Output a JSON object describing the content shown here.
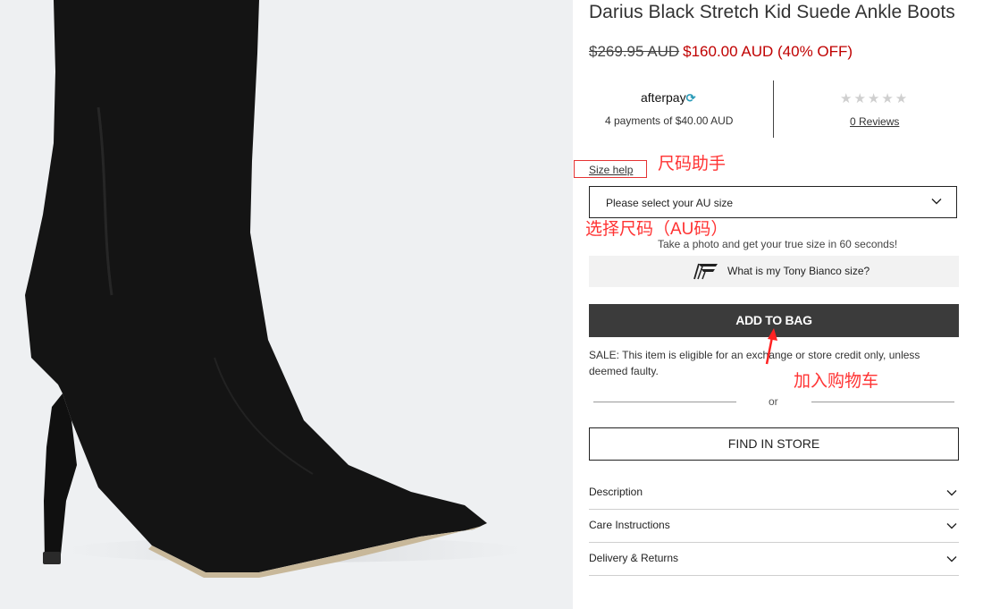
{
  "product": {
    "title": "Darius Black Stretch Kid Suede Ankle Boots",
    "old_price": "$269.95 AUD",
    "new_price": "$160.00 AUD (40% OFF)"
  },
  "afterpay": {
    "logo_text": "afterpay",
    "installments": "4 payments of $40.00 AUD"
  },
  "reviews": {
    "stars": "★★★★★",
    "rating": 0,
    "link": "0 Reviews"
  },
  "size": {
    "help_link": "Size help",
    "select_placeholder": "Please select your AU size",
    "photo_text": "Take a photo and get your true size in 60 seconds!",
    "tony_button": "What is my Tony Bianco size?"
  },
  "cart": {
    "add_to_bag": "ADD TO BAG",
    "sale_note": "SALE: This item is eligible for an exchange or store credit only, unless deemed faulty.",
    "or_text": "or",
    "find_in_store": "FIND IN STORE"
  },
  "accordion": [
    {
      "label": "Description"
    },
    {
      "label": "Care Instructions"
    },
    {
      "label": "Delivery & Returns"
    }
  ],
  "annotations": {
    "size_help": "尺码助手",
    "select_size": "选择尺码（AU码）",
    "add_to_bag": "加入购物车"
  },
  "colors": {
    "sale_red": "#c00000",
    "annotation_red": "#ff3333",
    "button_dark": "#3b3b3b",
    "afterpay_teal": "#2b9bb8"
  }
}
